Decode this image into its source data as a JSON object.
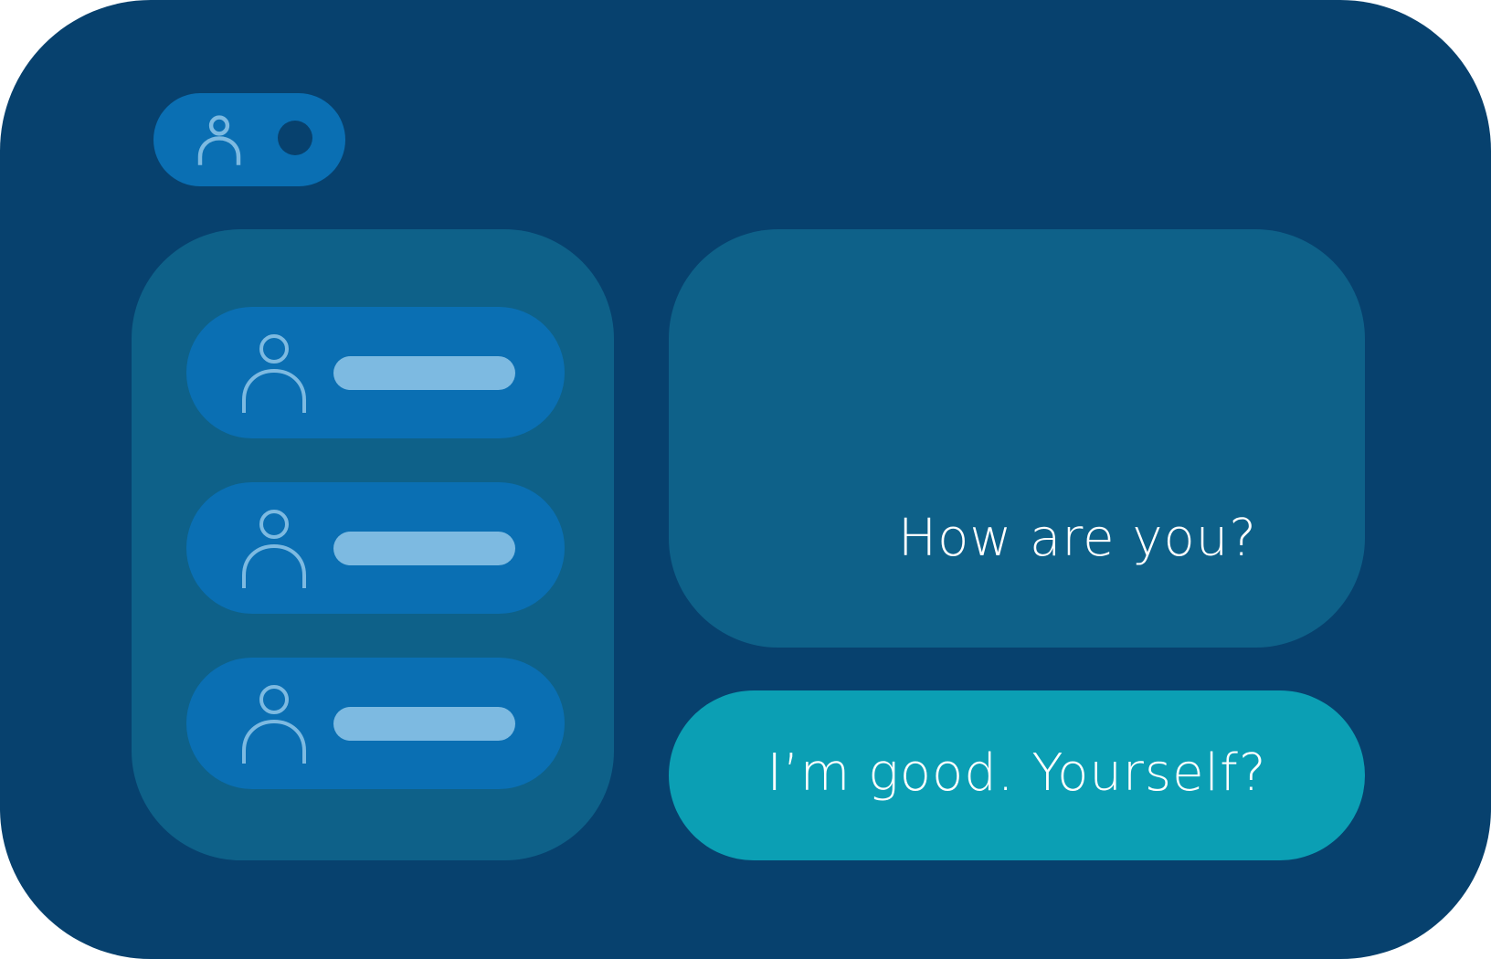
{
  "colors": {
    "window_bg": "#07416e",
    "panel_bg": "#0e6189",
    "pill_bg": "#0a6fb3",
    "placeholder_bar": "#7dbae1",
    "icon_stroke": "#7dbae1",
    "status_dot": "#07416e",
    "outgoing_bubble": "#0b9fb4",
    "message_text": "#ffffff"
  },
  "header": {
    "profile_icon": "person-icon",
    "status_icon": "status-dot"
  },
  "contacts": {
    "items": [
      {
        "icon": "person-icon"
      },
      {
        "icon": "person-icon"
      },
      {
        "icon": "person-icon"
      }
    ]
  },
  "chat": {
    "messages": [
      {
        "direction": "incoming",
        "text": "How are you?"
      },
      {
        "direction": "outgoing",
        "text": "I’m good. Yourself?"
      }
    ]
  }
}
